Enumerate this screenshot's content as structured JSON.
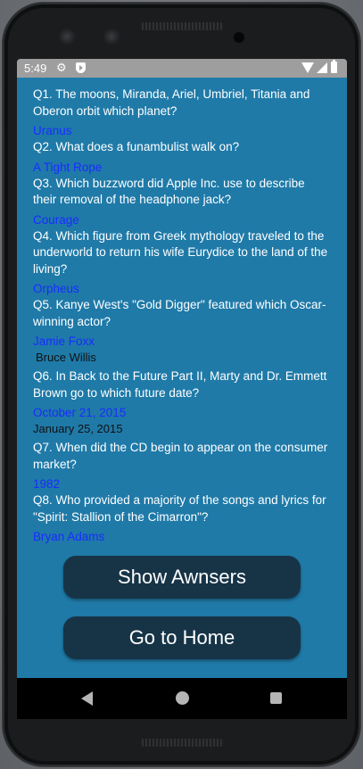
{
  "status": {
    "time": "5:49",
    "icons": [
      "gear-icon",
      "shield-play-icon",
      "wifi-icon",
      "signal-icon",
      "battery-icon"
    ]
  },
  "quiz": {
    "items": [
      {
        "question": "Q1. The moons, Miranda, Ariel, Umbriel, Titania and Oberon orbit which planet?",
        "answer": "Uranus",
        "user_answer": ""
      },
      {
        "question": "Q2. What does a funambulist walk on?",
        "answer": "A Tight Rope",
        "user_answer": ""
      },
      {
        "question": "Q3. Which buzzword did Apple Inc. use to describe their removal of the headphone jack?",
        "answer": "Courage",
        "user_answer": ""
      },
      {
        "question": "Q4. Which figure from Greek mythology traveled to the underworld to return his wife Eurydice to the land of the living?",
        "answer": "Orpheus",
        "user_answer": ""
      },
      {
        "question": "Q5. Kanye West's \"Gold Digger\" featured which Oscar-winning actor?",
        "answer": "Jamie Foxx",
        "user_answer": "Bruce Willis"
      },
      {
        "question": "Q6. In Back to the Future Part II, Marty and Dr. Emmett Brown go to which future date?",
        "answer": "October 21, 2015",
        "user_answer": "January 25, 2015"
      },
      {
        "question": "Q7. When did the CD begin to appear on the consumer market?",
        "answer": "1982",
        "user_answer": ""
      },
      {
        "question": "Q8. Who provided a majority of the songs and lyrics for \"Spirit: Stallion of the Cimarron\"?",
        "answer": "Bryan Adams",
        "user_answer": ""
      }
    ]
  },
  "buttons": {
    "show_answers": "Show Awnsers",
    "go_home": "Go to Home"
  },
  "colors": {
    "screen_bg": "#1f7aa8",
    "answer_text": "#1a2cff",
    "button_bg": "#173447",
    "status_bar": "#9e9e9e"
  }
}
